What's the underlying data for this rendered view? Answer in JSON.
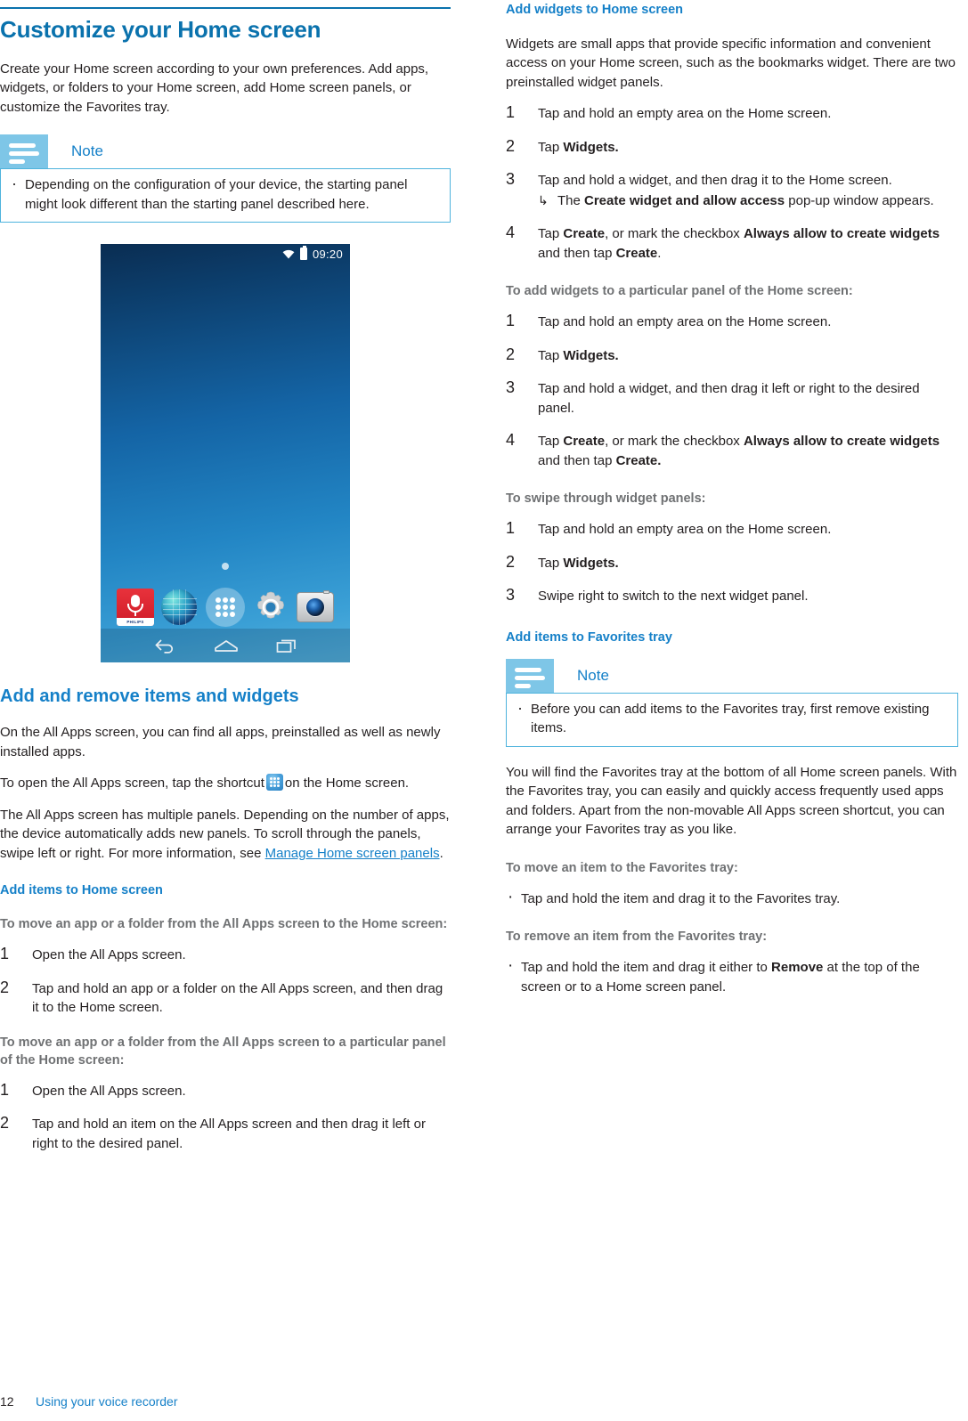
{
  "document": {
    "footer": {
      "page_number": "12",
      "running_title": "Using your voice recorder"
    }
  },
  "left_column": {
    "chapter_title": "Customize your Home screen",
    "intro_paragraph": "Create your Home screen according to your own preferences. Add apps, widgets, or folders to your Home screen, add Home screen panels, or customize the Favorites tray.",
    "note": {
      "label": "Note",
      "items": [
        "Depending on the configuration of your device, the starting panel might look different than the starting panel described here."
      ]
    },
    "phone_screenshot": {
      "status_bar": {
        "time": "09:20",
        "wifi_icon": "wifi-icon",
        "battery_icon": "battery-icon"
      },
      "favorites_tray": [
        {
          "name": "voice-recorder-app-icon",
          "brand_text": "PHILIPS"
        },
        {
          "name": "browser-app-icon"
        },
        {
          "name": "all-apps-shortcut-icon"
        },
        {
          "name": "settings-app-icon"
        },
        {
          "name": "camera-app-icon"
        }
      ],
      "nav_bar": [
        {
          "name": "back-nav-icon"
        },
        {
          "name": "home-nav-icon"
        },
        {
          "name": "recents-nav-icon"
        }
      ],
      "page_indicator_dots": 1
    },
    "section_add_remove": {
      "title": "Add and remove items and widgets",
      "paragraph_1": "On the All Apps screen, you can find all apps, preinstalled as well as newly installed apps.",
      "paragraph_2_before_icon": "To open the All Apps screen, tap the shortcut",
      "paragraph_2_after_icon": "on the Home screen.",
      "paragraph_3_before_link": "The All Apps screen has multiple panels. Depending on the number of apps, the device automatically adds new panels. To scroll through the panels, swipe left or right. For more information, see ",
      "paragraph_3_link": "Manage Home screen panels",
      "paragraph_3_after_link": "."
    },
    "section_add_items_home": {
      "title": "Add items to Home screen",
      "lead_1": "To move an app or a folder from the All Apps screen to the Home screen:",
      "steps_1": [
        {
          "num": "1",
          "text": "Open the All Apps screen."
        },
        {
          "num": "2",
          "text": "Tap and hold an app or a folder on the All Apps screen, and then drag it to the Home screen."
        }
      ],
      "lead_2": "To move an app or a folder from the All Apps screen to a particular panel of the Home screen:",
      "steps_2": [
        {
          "num": "1",
          "text": "Open the All Apps screen."
        },
        {
          "num": "2",
          "text": "Tap and hold an item on the All Apps screen and then drag it left or right to the desired panel."
        }
      ]
    }
  },
  "right_column": {
    "section_add_widgets": {
      "title": "Add widgets to Home screen",
      "paragraph": "Widgets are small apps that provide specific information and convenient access on your Home screen, such as the bookmarks widget. There are two preinstalled widget panels.",
      "steps": [
        {
          "num": "1",
          "text": "Tap and hold an empty area on the Home screen."
        },
        {
          "num": "2",
          "prefix": "Tap ",
          "bold": "Widgets.",
          "suffix": ""
        },
        {
          "num": "3",
          "text": "Tap and hold a widget, and then drag it to the Home screen.",
          "substep_prefix": "The ",
          "substep_bold": "Create widget and allow access",
          "substep_suffix": " pop-up window appears."
        },
        {
          "num": "4",
          "p1": "Tap ",
          "b1": "Create",
          "p2": ", or mark the checkbox ",
          "b2": "Always allow to create widgets",
          "p3": " and then tap ",
          "b3": "Create",
          "p4": "."
        }
      ],
      "lead_particular_panel": "To add widgets to a particular panel of the Home screen:",
      "steps_particular_panel": [
        {
          "num": "1",
          "text": "Tap and hold an empty area on the Home screen."
        },
        {
          "num": "2",
          "prefix": "Tap ",
          "bold": "Widgets.",
          "suffix": ""
        },
        {
          "num": "3",
          "text": "Tap and hold a widget, and then drag it left or right to the desired panel."
        },
        {
          "num": "4",
          "p1": "Tap ",
          "b1": "Create",
          "p2": ", or mark the checkbox ",
          "b2": "Always allow to create widgets",
          "p3": " and then tap ",
          "b3": "Create.",
          "p4": ""
        }
      ],
      "lead_swipe": "To swipe through widget panels:",
      "steps_swipe": [
        {
          "num": "1",
          "text": "Tap and hold an empty area on the Home screen."
        },
        {
          "num": "2",
          "prefix": "Tap ",
          "bold": "Widgets.",
          "suffix": ""
        },
        {
          "num": "3",
          "text": "Swipe right to switch to the next widget panel."
        }
      ]
    },
    "section_favorites": {
      "title": "Add items to Favorites tray",
      "note": {
        "label": "Note",
        "items": [
          "Before you can add items to the Favorites tray, first remove existing items."
        ]
      },
      "paragraph": "You will find the Favorites tray at the bottom of all Home screen panels. With the Favorites tray, you can easily and quickly access frequently used apps and folders. Apart from the non-movable All Apps screen shortcut, you can arrange your Favorites tray as you like.",
      "lead_move": "To move an item to the Favorites tray:",
      "bullet_move": "Tap and hold the item and drag it to the Favorites tray.",
      "lead_remove": "To remove an item from the Favorites tray:",
      "bullet_remove": {
        "p1": "Tap and hold the item and drag it either to ",
        "b1": "Remove",
        "p2": " at the top of the screen or to a Home screen panel."
      }
    }
  },
  "colors": {
    "heading_blue": "#0a72ad",
    "section_blue": "#1580c8",
    "note_icon_bg": "#7ec6e7",
    "note_border": "#4eb3dd",
    "lead_gray": "#6f7173",
    "body_black": "#231f20"
  }
}
